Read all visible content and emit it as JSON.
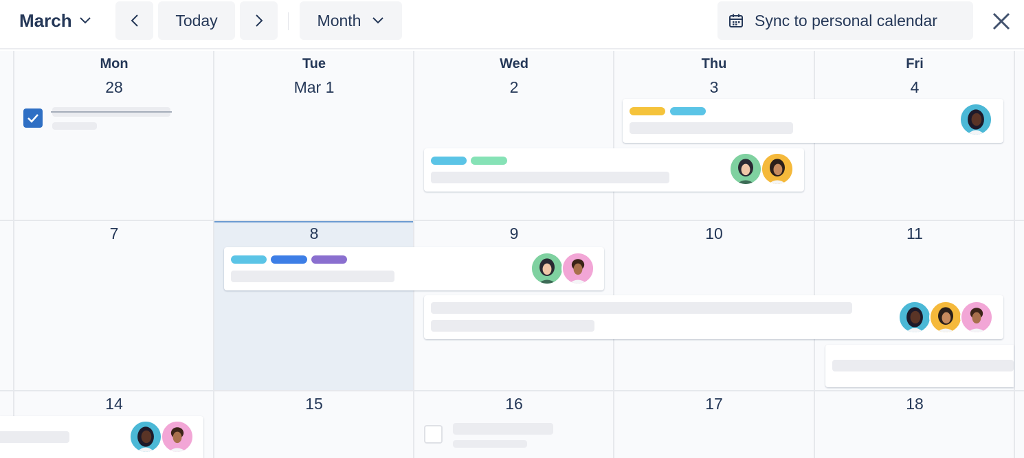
{
  "toolbar": {
    "month_label": "March",
    "today_label": "Today",
    "view_label": "Month",
    "sync_label": "Sync to personal calendar"
  },
  "weekdays": [
    "Mon",
    "Tue",
    "Wed",
    "Thu",
    "Fri"
  ],
  "weeks": [
    [
      "28",
      "Mar 1",
      "2",
      "3",
      "4"
    ],
    [
      "7",
      "8",
      "9",
      "10",
      "11"
    ],
    [
      "14",
      "15",
      "16",
      "17",
      "18"
    ]
  ],
  "colors": {
    "accent": "#2f6fc4",
    "pill_yellow": "#f5c33b",
    "pill_cyan": "#5bc4e6",
    "pill_mint": "#86e2b6",
    "pill_blue": "#3d7ee6",
    "pill_purple": "#8a6fcf",
    "today_bg": "#e8eef5"
  },
  "icons": {
    "prev": "chevron-left-icon",
    "next": "chevron-right-icon",
    "dropdown": "chevron-down-icon",
    "calendar": "calendar-icon",
    "close": "close-icon"
  }
}
